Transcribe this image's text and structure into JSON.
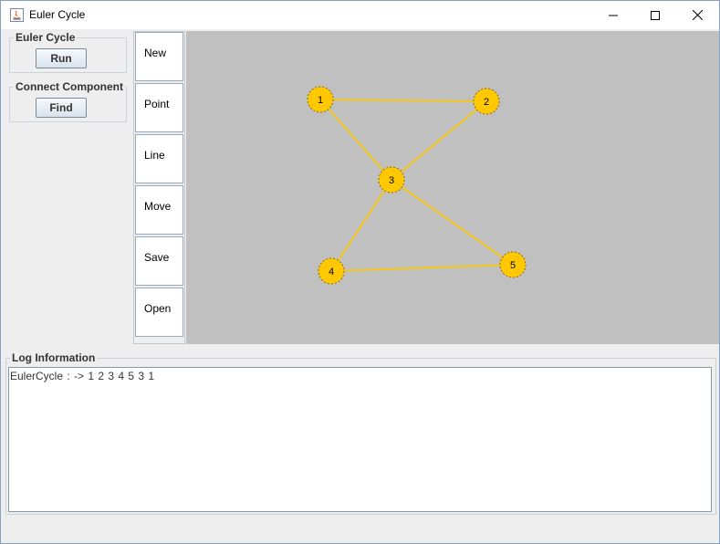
{
  "window": {
    "title": "Euler Cycle",
    "controls": [
      "minimize",
      "maximize",
      "close"
    ]
  },
  "left_panel": {
    "euler_group": {
      "label": "Euler Cycle",
      "button": "Run"
    },
    "connect_group": {
      "label": "Connect Component",
      "button": "Find"
    }
  },
  "toolbar": {
    "buttons": [
      "New",
      "Point",
      "Line",
      "Move",
      "Save",
      "Open"
    ]
  },
  "graph": {
    "node_color": "#ffc800",
    "edge_color": "#f5c518",
    "background": "#c0c0c0",
    "nodes": [
      {
        "label": "1"
      },
      {
        "label": "2"
      },
      {
        "label": "3"
      },
      {
        "label": "4"
      },
      {
        "label": "5"
      }
    ],
    "edges": [
      [
        "1",
        "2"
      ],
      [
        "1",
        "3"
      ],
      [
        "2",
        "3"
      ],
      [
        "3",
        "4"
      ],
      [
        "3",
        "5"
      ],
      [
        "4",
        "5"
      ]
    ]
  },
  "log": {
    "label": "Log Information",
    "text": "EulerCycle : -> 1  2  3  4  5  3  1"
  }
}
